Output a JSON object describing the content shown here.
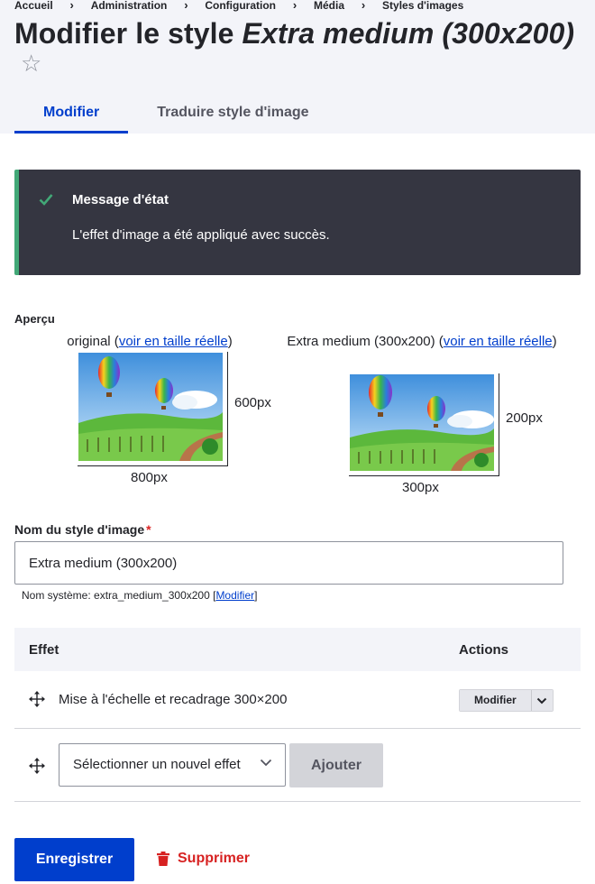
{
  "breadcrumb": [
    "Accueil",
    "Administration",
    "Configuration",
    "Média",
    "Styles d'images"
  ],
  "title": {
    "prefix": "Modifier le style ",
    "style_name": "Extra medium (300x200)"
  },
  "favorite_star": "☆",
  "tabs": [
    {
      "label": "Modifier",
      "active": true
    },
    {
      "label": "Traduire style d'image",
      "active": false
    }
  ],
  "status_message": {
    "title": "Message d'état",
    "text": "L'effet d'image a été appliqué avec succès."
  },
  "preview": {
    "label": "Aperçu",
    "original": {
      "caption_prefix": "original (",
      "link": "voir en taille réelle",
      "caption_suffix": ")",
      "width_label": "800px",
      "height_label": "600px"
    },
    "derivative": {
      "caption_prefix": "Extra medium (300x200) (",
      "link": "voir en taille réelle",
      "caption_suffix": ")",
      "width_label": "300px",
      "height_label": "200px"
    }
  },
  "name_field": {
    "label": "Nom du style d'image",
    "required_marker": "*",
    "value": "Extra medium (300x200)",
    "machine_prefix": "Nom système: extra_medium_300x200 [",
    "machine_link": "Modifier",
    "machine_suffix": "]"
  },
  "effects_table": {
    "headers": {
      "effect": "Effet",
      "actions": "Actions"
    },
    "rows": [
      {
        "effect": "Mise à l'échelle et recadrage 300×200",
        "action_label": "Modifier"
      }
    ],
    "new_effect": {
      "select_value": "Sélectionner un nouvel effet",
      "add_label": "Ajouter"
    }
  },
  "form_actions": {
    "save": "Enregistrer",
    "delete": "Supprimer"
  },
  "colors": {
    "primary": "#003ecc",
    "status_bg": "#353641",
    "status_accent": "#42a877",
    "danger": "#d72222",
    "header_bg": "#f3f4f9"
  }
}
